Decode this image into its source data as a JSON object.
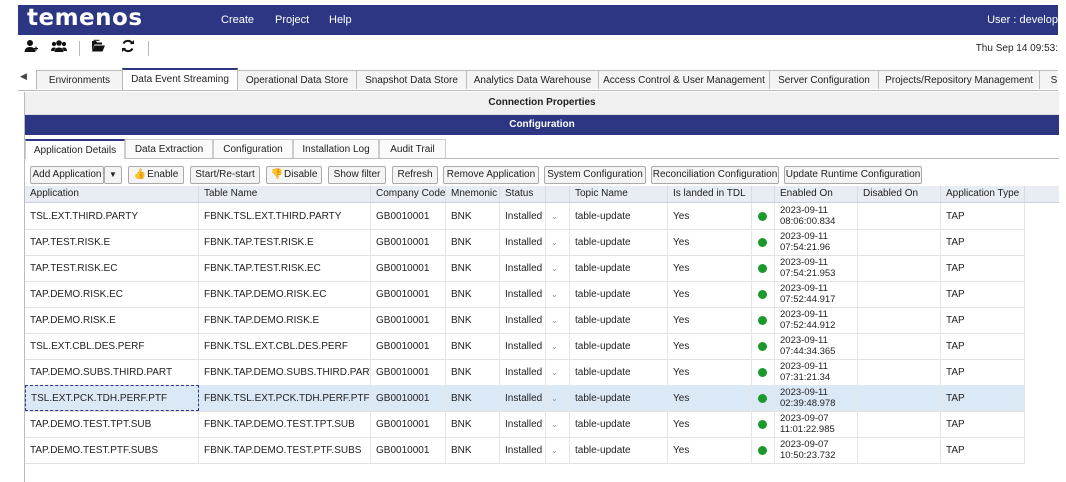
{
  "header": {
    "logo": "temenos",
    "nav": [
      "Create",
      "Project",
      "Help"
    ],
    "user": "User : develop"
  },
  "toolbar": {
    "icons": [
      "user-icon",
      "users-icon",
      "folder-open-icon",
      "refresh-icon"
    ],
    "datetime": "Thu Sep 14 09:53:"
  },
  "main_tabs": [
    "Environments",
    "Data Event Streaming",
    "Operational Data Store",
    "Snapshot Data Store",
    "Analytics Data Warehouse",
    "Access Control & User Management",
    "Server Configuration",
    "Projects/Repository Management",
    "S"
  ],
  "active_main_tab": "Data Event Streaming",
  "connection_title": "Connection Properties",
  "configuration_title": "Configuration",
  "sub_tabs": [
    "Application Details",
    "Data Extraction",
    "Configuration",
    "Installation Log",
    "Audit Trail"
  ],
  "actions": {
    "add_application": "Add Application",
    "add_arrow": "▼",
    "enable": "Enable",
    "start_restart": "Start/Re-start",
    "disable": "Disable",
    "show_filter": "Show filter",
    "refresh": "Refresh",
    "remove_application": "Remove Application",
    "system_configuration": "System Configuration",
    "reconciliation_configuration": "Reconciliation Configuration",
    "update_runtime_configuration": "Update Runtime Configuration"
  },
  "columns": [
    "Application",
    "Table Name",
    "Company Code",
    "Mnemonic",
    "Status",
    "",
    "Topic Name",
    "Is landed in TDL",
    "",
    "Enabled On",
    "Disabled On",
    "Application Type"
  ],
  "rows": [
    {
      "app": "TSL.EXT.THIRD.PARTY",
      "table": "FBNK.TSL.EXT.THIRD.PARTY",
      "company": "GB0010001",
      "mnemonic": "BNK",
      "status": "Installed",
      "topic": "table-update",
      "landed": "Yes",
      "enabled_date": "2023-09-11",
      "enabled_time": "08:06:00.834",
      "disabled": "",
      "type": "TAP"
    },
    {
      "app": "TAP.TEST.RISK.E",
      "table": "FBNK.TAP.TEST.RISK.E",
      "company": "GB0010001",
      "mnemonic": "BNK",
      "status": "Installed",
      "topic": "table-update",
      "landed": "Yes",
      "enabled_date": "2023-09-11",
      "enabled_time": "07:54:21.96",
      "disabled": "",
      "type": "TAP"
    },
    {
      "app": "TAP.TEST.RISK.EC",
      "table": "FBNK.TAP.TEST.RISK.EC",
      "company": "GB0010001",
      "mnemonic": "BNK",
      "status": "Installed",
      "topic": "table-update",
      "landed": "Yes",
      "enabled_date": "2023-09-11",
      "enabled_time": "07:54:21.953",
      "disabled": "",
      "type": "TAP"
    },
    {
      "app": "TAP.DEMO.RISK.EC",
      "table": "FBNK.TAP.DEMO.RISK.EC",
      "company": "GB0010001",
      "mnemonic": "BNK",
      "status": "Installed",
      "topic": "table-update",
      "landed": "Yes",
      "enabled_date": "2023-09-11",
      "enabled_time": "07:52:44.917",
      "disabled": "",
      "type": "TAP"
    },
    {
      "app": "TAP.DEMO.RISK.E",
      "table": "FBNK.TAP.DEMO.RISK.E",
      "company": "GB0010001",
      "mnemonic": "BNK",
      "status": "Installed",
      "topic": "table-update",
      "landed": "Yes",
      "enabled_date": "2023-09-11",
      "enabled_time": "07:52:44.912",
      "disabled": "",
      "type": "TAP"
    },
    {
      "app": "TSL.EXT.CBL.DES.PERF",
      "table": "FBNK.TSL.EXT.CBL.DES.PERF",
      "company": "GB0010001",
      "mnemonic": "BNK",
      "status": "Installed",
      "topic": "table-update",
      "landed": "Yes",
      "enabled_date": "2023-09-11",
      "enabled_time": "07:44:34.365",
      "disabled": "",
      "type": "TAP"
    },
    {
      "app": "TAP.DEMO.SUBS.THIRD.PART",
      "table": "FBNK.TAP.DEMO.SUBS.THIRD.PART",
      "company": "GB0010001",
      "mnemonic": "BNK",
      "status": "Installed",
      "topic": "table-update",
      "landed": "Yes",
      "enabled_date": "2023-09-11",
      "enabled_time": "07:31:21.34",
      "disabled": "",
      "type": "TAP"
    },
    {
      "app": "TSL.EXT.PCK.TDH.PERF.PTF",
      "table": "FBNK.TSL.EXT.PCK.TDH.PERF.PTF",
      "company": "GB0010001",
      "mnemonic": "BNK",
      "status": "Installed",
      "topic": "table-update",
      "landed": "Yes",
      "enabled_date": "2023-09-11",
      "enabled_time": "02:39:48.978",
      "disabled": "",
      "type": "TAP",
      "selected": true
    },
    {
      "app": "TAP.DEMO.TEST.TPT.SUB",
      "table": "FBNK.TAP.DEMO.TEST.TPT.SUB",
      "company": "GB0010001",
      "mnemonic": "BNK",
      "status": "Installed",
      "topic": "table-update",
      "landed": "Yes",
      "enabled_date": "2023-09-07",
      "enabled_time": "11:01:22.985",
      "disabled": "",
      "type": "TAP"
    },
    {
      "app": "TAP.DEMO.TEST.PTF.SUBS",
      "table": "FBNK.TAP.DEMO.TEST.PTF.SUBS",
      "company": "GB0010001",
      "mnemonic": "BNK",
      "status": "Installed",
      "topic": "table-update",
      "landed": "Yes",
      "enabled_date": "2023-09-07",
      "enabled_time": "10:50:23.732",
      "disabled": "",
      "type": "TAP"
    }
  ],
  "status_dot_color": "#1b9a2b",
  "accent_color": "#2c3682"
}
